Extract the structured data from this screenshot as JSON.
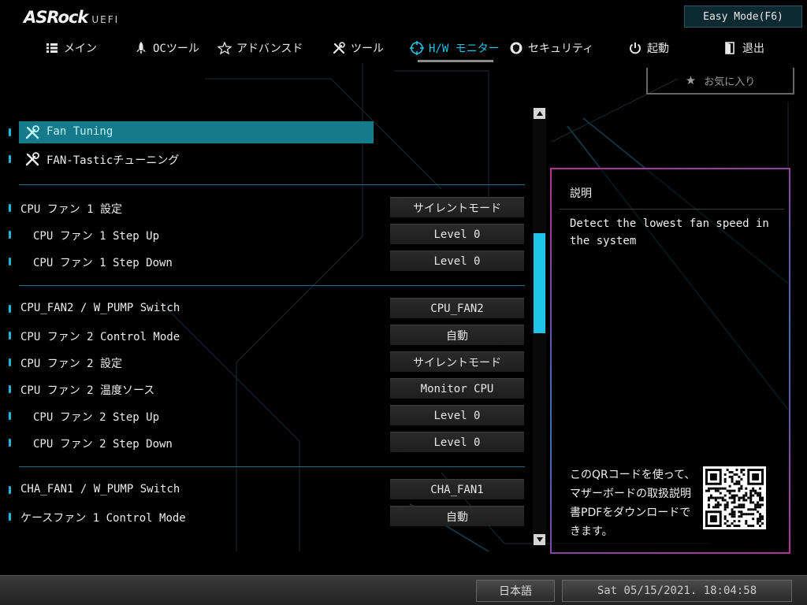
{
  "header": {
    "logo_main": "ASRock",
    "logo_sub": "UEFI",
    "easy_mode_label": "Easy Mode(F6)",
    "favorites_label": "お気に入り"
  },
  "nav": {
    "tabs": [
      {
        "label": "メイン",
        "icon": "list-icon"
      },
      {
        "label": "OCツール",
        "icon": "rocket-icon"
      },
      {
        "label": "アドバンスド",
        "icon": "star-outline-icon"
      },
      {
        "label": "ツール",
        "icon": "tools-icon"
      },
      {
        "label": "H/W モニター",
        "icon": "monitor-icon",
        "active": true
      },
      {
        "label": "セキュリティ",
        "icon": "shield-icon"
      },
      {
        "label": "起動",
        "icon": "power-icon"
      },
      {
        "label": "退出",
        "icon": "exit-icon"
      }
    ]
  },
  "menu": [
    {
      "label": "Fan Tuning",
      "selected": true
    },
    {
      "label": "FAN-Tasticチューニング"
    }
  ],
  "settings": [
    {
      "label": "CPU ファン 1 設定",
      "value": "サイレントモード"
    },
    {
      "label": "CPU ファン 1 Step Up",
      "value": "Level 0"
    },
    {
      "label": "CPU ファン 1 Step Down",
      "value": "Level 0"
    },
    {
      "label": "CPU_FAN2 / W_PUMP Switch",
      "value": "CPU_FAN2"
    },
    {
      "label": "CPU ファン 2 Control Mode",
      "value": "自動"
    },
    {
      "label": "CPU ファン 2 設定",
      "value": "サイレントモード"
    },
    {
      "label": "CPU ファン 2 温度ソース",
      "value": "Monitor CPU"
    },
    {
      "label": "CPU ファン 2 Step Up",
      "value": "Level 0"
    },
    {
      "label": "CPU ファン 2 Step Down",
      "value": "Level 0"
    },
    {
      "label": "CHA_FAN1 / W_PUMP Switch",
      "value": "CHA_FAN1"
    },
    {
      "label": "ケースファン 1 Control Mode",
      "value": "自動"
    }
  ],
  "description": {
    "title": "説明",
    "text": "Detect the lowest fan speed in the system",
    "qr_text": "このQRコードを使って、マザーボードの取扱説明書PDFをダウンロードできます。"
  },
  "footer": {
    "language": "日本語",
    "datetime": "Sat 05/15/2021. 18:04:58"
  },
  "colors": {
    "accent": "#1fc4e6",
    "selection": "#167a8a"
  }
}
